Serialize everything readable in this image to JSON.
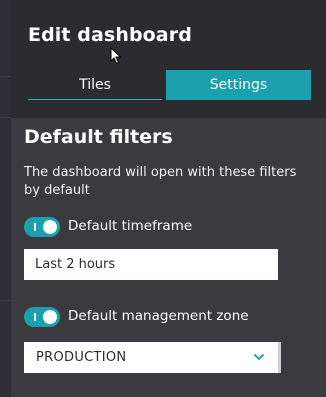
{
  "panel": {
    "title": "Edit dashboard",
    "tabs": [
      {
        "label": "Tiles",
        "active": false
      },
      {
        "label": "Settings",
        "active": true
      }
    ]
  },
  "settings": {
    "section_title": "Default filters",
    "description": "The dashboard will open with these filters by default",
    "timeframe": {
      "toggle_label": "Default timeframe",
      "enabled": true,
      "value": "Last 2 hours"
    },
    "management_zone": {
      "toggle_label": "Default management zone",
      "enabled": true,
      "selected": "PRODUCTION"
    }
  },
  "colors": {
    "accent": "#1aa1ad",
    "panel_bg": "#3a3a3f",
    "header_bg": "#2b2b30"
  }
}
